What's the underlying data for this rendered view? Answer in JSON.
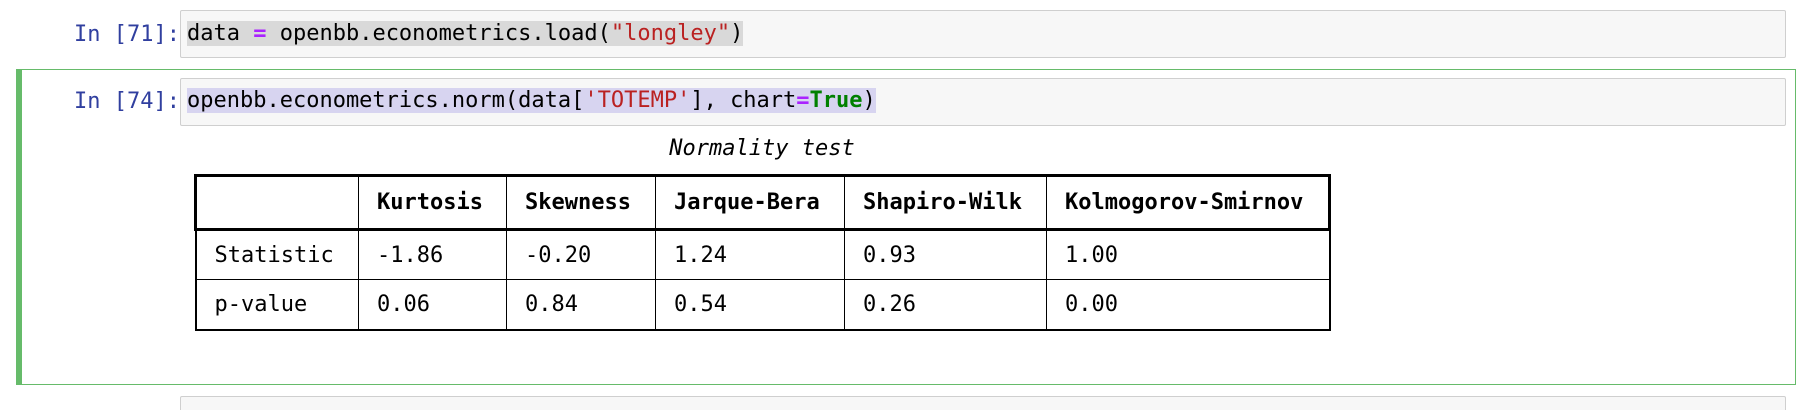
{
  "cells": [
    {
      "prompt": "In [71]:",
      "code": {
        "t1": "data ",
        "op1": "=",
        "t2": " openbb.econometrics.load(",
        "s1": "\"longley\"",
        "t3": ")"
      }
    },
    {
      "prompt": "In [74]:",
      "code": {
        "t1": "openbb.econometrics.norm(data[",
        "s1": "'TOTEMP'",
        "t2": "], chart",
        "op1": "=",
        "kw1": "True",
        "t3": ")"
      },
      "output": {
        "caption": "Normality test",
        "table": {
          "headers": [
            "",
            "Kurtosis",
            "Skewness",
            "Jarque-Bera",
            "Shapiro-Wilk",
            "Kolmogorov-Smirnov"
          ],
          "rows": [
            [
              "Statistic",
              "-1.86",
              "-0.20",
              "1.24",
              "0.93",
              "1.00"
            ],
            [
              "p-value",
              "0.06",
              "0.84",
              "0.54",
              "0.26",
              "0.00"
            ]
          ]
        }
      }
    }
  ],
  "colors": {
    "prompt": "#303f9f",
    "selected_border": "#66bb6a",
    "string": "#ba2121",
    "operator": "#aa22ff",
    "keyword": "#008000"
  }
}
